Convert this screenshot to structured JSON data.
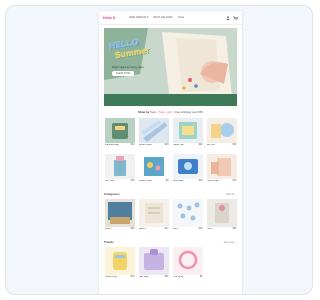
{
  "colors": {
    "accent": "#e3447a",
    "hero_bg": "#c9d8cc",
    "frame_bg": "#f3f6fb"
  },
  "nav": {
    "logo": "Hello S",
    "links": [
      "NEW ARRIVALS",
      "BEST SELLERS",
      "SALE"
    ],
    "icons": [
      "user-icon",
      "cart-icon"
    ]
  },
  "hero": {
    "title_line1": "HELLO",
    "title_line2": "Summer",
    "subtitle": "Bright styles for sunny days",
    "cta": "SHOP NOW"
  },
  "category_line": {
    "lead": "Shop by",
    "items": "Bags · Tops · Acc",
    "tail": "· Free shipping over $50"
  },
  "sections": [
    {
      "title": "",
      "link": "",
      "products": [
        {
          "name": "Rainbow Bag",
          "price": "$24"
        },
        {
          "name": "Stripe Pouch",
          "price": "$18"
        },
        {
          "name": "Pastel Tee",
          "price": "$22"
        },
        {
          "name": "Sky Set",
          "price": "$30"
        },
        {
          "name": "Mini Tote",
          "price": "$16"
        },
        {
          "name": "Sticker Pack",
          "price": "$8"
        },
        {
          "name": "Blue Case",
          "price": "$19"
        },
        {
          "name": "Peach Cap",
          "price": "$14"
        }
      ]
    },
    {
      "title": "Categories",
      "link": "View all →",
      "products": [
        {
          "name": "Denim",
          "price": "$28"
        },
        {
          "name": "Basics",
          "price": "$12"
        },
        {
          "name": "Dots",
          "price": "$20"
        },
        {
          "name": "Linen",
          "price": "$26"
        }
      ]
    },
    {
      "title": "Trends",
      "link": "See more →",
      "products": [
        {
          "name": "Lemon Cup",
          "price": "$10"
        },
        {
          "name": "Lilac Bag",
          "price": "$21"
        },
        {
          "name": "Pink Ring",
          "price": "$9"
        },
        {
          "name": "",
          "price": ""
        }
      ]
    }
  ]
}
